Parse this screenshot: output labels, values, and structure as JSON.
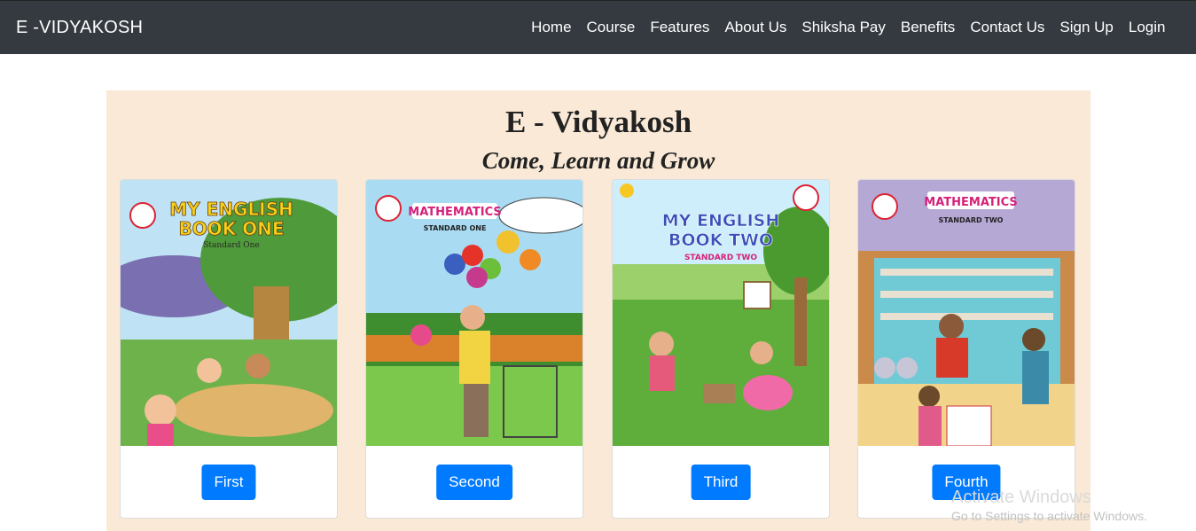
{
  "navbar": {
    "brand": "E -VIDYAKOSH",
    "links": [
      "Home",
      "Course",
      "Features",
      "About Us",
      "Shiksha Pay",
      "Benefits",
      "Contact Us",
      "Sign Up",
      "Login"
    ]
  },
  "hero": {
    "title": "E - Vidyakosh",
    "subtitle": "Come, Learn and Grow"
  },
  "cards": [
    {
      "button": "First",
      "cover_title_1": "MY ENGLISH",
      "cover_title_2": "BOOK ONE",
      "cover_sub": "Standard One"
    },
    {
      "button": "Second",
      "cover_title_1": "MATHEMATICS",
      "cover_sub": "STANDARD ONE"
    },
    {
      "button": "Third",
      "cover_title_1": "MY ENGLISH",
      "cover_title_2": "BOOK TWO",
      "cover_sub": "STANDARD TWO"
    },
    {
      "button": "Fourth",
      "cover_title_1": "MATHEMATICS",
      "cover_sub": "STANDARD TWO"
    }
  ],
  "watermark": {
    "title": "Activate Windows",
    "subtitle": "Go to Settings to activate Windows."
  },
  "colors": {
    "navbar": "#343a40",
    "hero_bg": "#f9e9d6",
    "button": "#007bff"
  }
}
